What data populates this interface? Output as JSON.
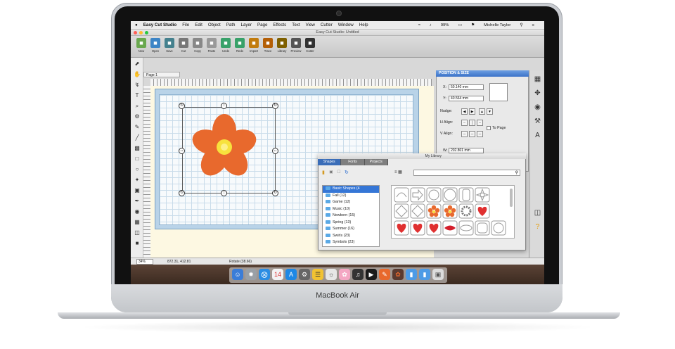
{
  "device": {
    "brand": "MacBook Air"
  },
  "menubar": {
    "apple": "",
    "app_name": "Easy Cut Studio",
    "menus": [
      "File",
      "Edit",
      "Object",
      "Path",
      "Layer",
      "Page",
      "Effects",
      "Text",
      "View",
      "Cutter",
      "Window",
      "Help"
    ],
    "battery": "99%",
    "user": "Michelle Taylor"
  },
  "window": {
    "title": "Easy Cut Studio: Untitled"
  },
  "toolbar": {
    "tools": [
      {
        "label": "New",
        "icon": "new-doc-icon",
        "color": "#6aa84f"
      },
      {
        "label": "Open",
        "icon": "open-folder-icon",
        "color": "#3d85c6"
      },
      {
        "label": "Save",
        "icon": "save-disk-icon",
        "color": "#45818e"
      },
      {
        "label": "Cut",
        "icon": "scissors-icon",
        "color": "#777777"
      },
      {
        "label": "Copy",
        "icon": "copy-icon",
        "color": "#888888"
      },
      {
        "label": "Paste",
        "icon": "paste-icon",
        "color": "#999999"
      },
      {
        "label": "Undo",
        "icon": "undo-icon",
        "color": "#38a169"
      },
      {
        "label": "Redo",
        "icon": "redo-icon",
        "color": "#38a169"
      },
      {
        "label": "Import",
        "icon": "import-image-icon",
        "color": "#c27c0e"
      },
      {
        "label": "Trace",
        "icon": "trace-icon",
        "color": "#b45f06"
      },
      {
        "label": "Library",
        "icon": "library-icon",
        "color": "#7f6000"
      },
      {
        "label": "Preview",
        "icon": "preview-magnifier-icon",
        "color": "#555555"
      },
      {
        "label": "Cutter",
        "icon": "cutter-blade-icon",
        "color": "#333333"
      }
    ]
  },
  "page_tab": {
    "label": "Page 1"
  },
  "artwork": {
    "petal_color": "#e8692d",
    "center_color": "#f7e23d"
  },
  "position_panel": {
    "title": "POSITION & SIZE",
    "x_label": "X:",
    "x_value": "50.140 mm",
    "y_label": "Y:",
    "y_value": "40.564 mm",
    "nudge_label": "Nudge:",
    "halign_label": "H Align:",
    "valign_label": "V Align:",
    "to_page_label": "To Page",
    "w_label": "W:",
    "w_value": "202.801 mm"
  },
  "library": {
    "title": "My Library",
    "tabs": [
      "Shapes",
      "Fonts",
      "Projects"
    ],
    "categories": [
      "Basic Shapes (4",
      "Fall (12)",
      "Game (12)",
      "Music (10)",
      "Newborn (15)",
      "Spring (13)",
      "Summer (16)",
      "Swirls (23)",
      "Symbols (23)"
    ],
    "selected_category": 0,
    "view_icon": "≡ ▦"
  },
  "status": {
    "zoom": "34%",
    "coords": "872.31, 412.81",
    "rotate": "Rotate (38.66)"
  }
}
